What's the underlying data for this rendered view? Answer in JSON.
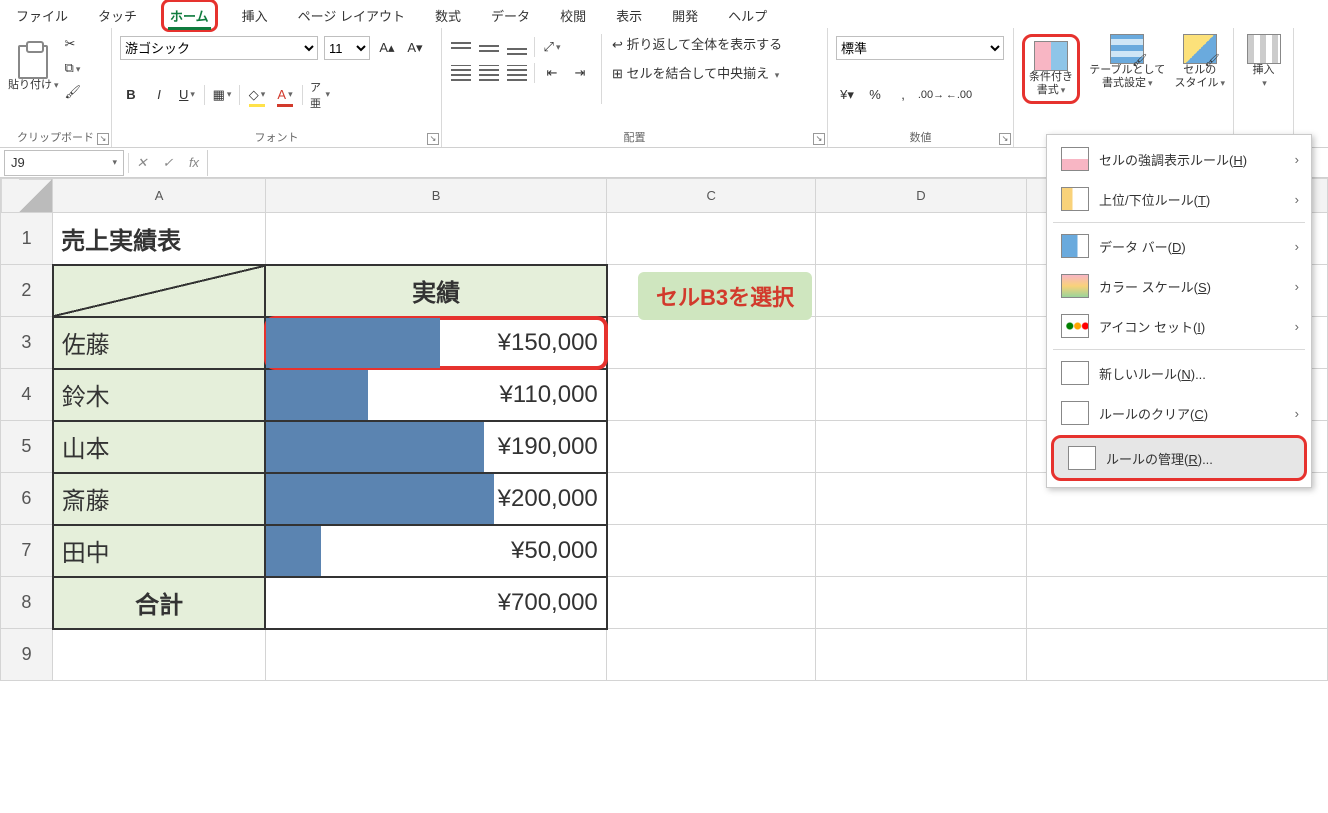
{
  "menu": {
    "file": "ファイル",
    "touch": "タッチ",
    "home": "ホーム",
    "insert": "挿入",
    "page": "ページ レイアウト",
    "formula": "数式",
    "data": "データ",
    "review": "校閲",
    "view": "表示",
    "dev": "開発",
    "help": "ヘルプ"
  },
  "ribbon": {
    "clipboard": {
      "paste": "貼り付け",
      "label": "クリップボード"
    },
    "font": {
      "name": "游ゴシック",
      "size": "11",
      "label": "フォント"
    },
    "align": {
      "wrap": "折り返して全体を表示する",
      "merge": "セルを結合して中央揃え",
      "label": "配置"
    },
    "number": {
      "fmt": "標準",
      "label": "数値"
    },
    "styles": {
      "cond": "条件付き\n書式",
      "table": "テーブルとして\n書式設定",
      "cell": "セルの\nスタイル"
    },
    "insert": "挿入"
  },
  "dropdown": {
    "highlight": "セルの強調表示ルール(",
    "highlight_u": "H",
    "topbottom": "上位/下位ルール(",
    "topbottom_u": "T",
    "databar": "データ バー(",
    "databar_u": "D",
    "colorscale": "カラー スケール(",
    "colorscale_u": "S",
    "iconset": "アイコン セット(",
    "iconset_u": "I",
    "newrule": "新しいルール(",
    "newrule_u": "N",
    "clear": "ルールのクリア(",
    "clear_u": "C",
    "manage": "ルールの管理(",
    "manage_u": "R",
    "close": ")",
    "dots": ")...",
    "dots2": ")..."
  },
  "namebox": "J9",
  "sheet": {
    "title": "売上実績表",
    "col_b": "実績",
    "rows": [
      {
        "name": "佐藤",
        "value": "¥150,000",
        "bar": 51
      },
      {
        "name": "鈴木",
        "value": "¥110,000",
        "bar": 30
      },
      {
        "name": "山本",
        "value": "¥190,000",
        "bar": 64
      },
      {
        "name": "斎藤",
        "value": "¥200,000",
        "bar": 67
      },
      {
        "name": "田中",
        "value": "¥50,000",
        "bar": 16
      }
    ],
    "total_label": "合計",
    "total_value": "¥700,000"
  },
  "callout": "セルB3を選択",
  "chart_data": {
    "type": "bar",
    "title": "売上実績表 — 実績 (データバー)",
    "categories": [
      "佐藤",
      "鈴木",
      "山本",
      "斎藤",
      "田中"
    ],
    "values": [
      150000,
      110000,
      190000,
      200000,
      50000
    ],
    "xlabel": "",
    "ylabel": "実績 (円)"
  }
}
